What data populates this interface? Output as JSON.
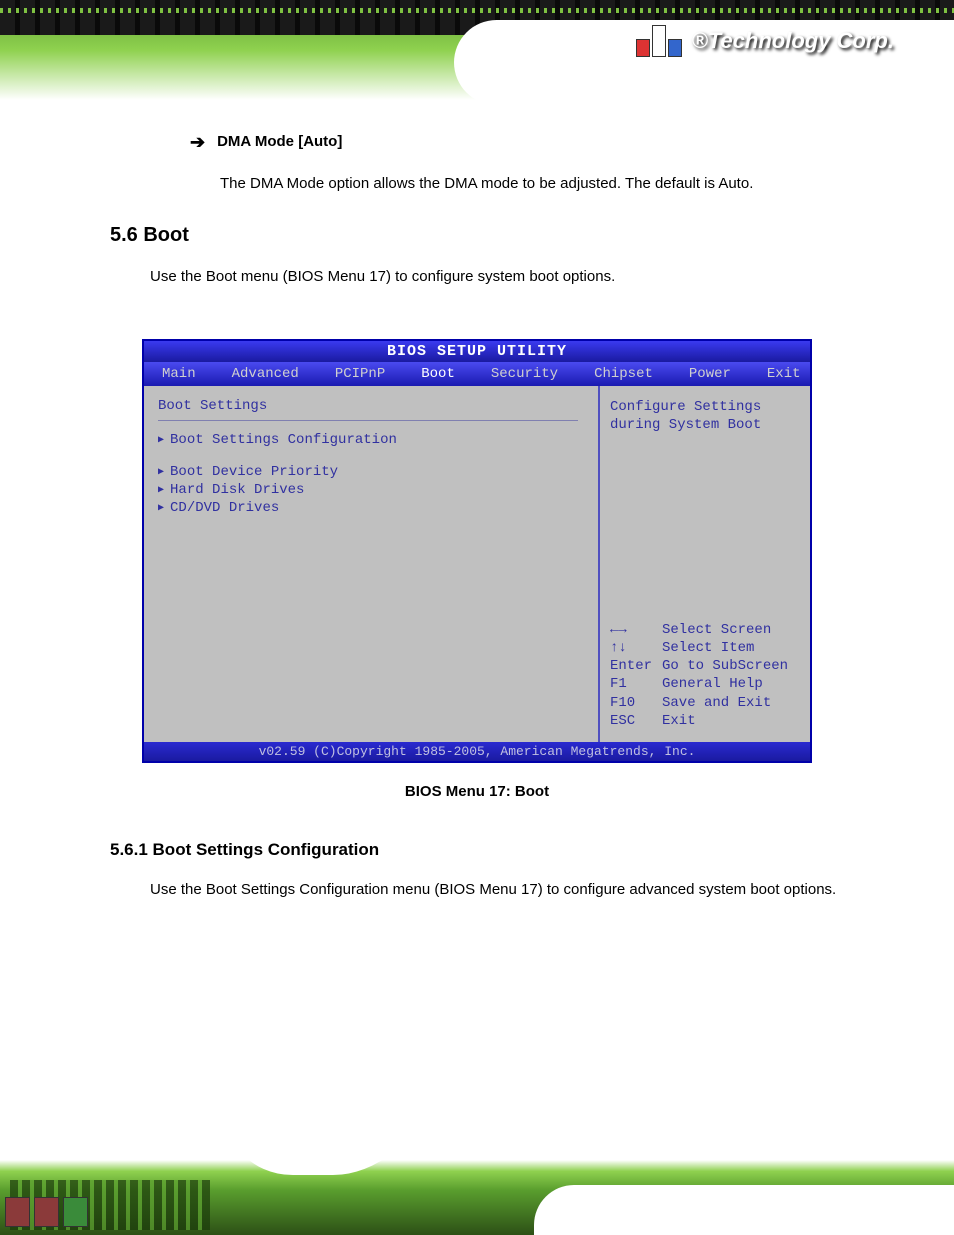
{
  "header": {
    "brand": "®Technology Corp."
  },
  "content": {
    "item1_label": "DMA Mode [Auto]",
    "item1_desc": "The DMA Mode option allows the DMA mode to be adjusted. The default is Auto.",
    "section_heading": "5.6 Boot",
    "section_desc": "Use the Boot menu (BIOS Menu 17) to configure system boot options."
  },
  "bios": {
    "title": "BIOS SETUP UTILITY",
    "tabs": [
      "Main",
      "Advanced",
      "PCIPnP",
      "Boot",
      "Security",
      "Chipset",
      "Power",
      "Exit"
    ],
    "active_tab_index": 3,
    "panel_title": "Boot Settings",
    "menu_items": [
      "Boot Settings Configuration",
      "Boot Device Priority",
      "Hard Disk Drives",
      "CD/DVD Drives"
    ],
    "help_text": "Configure Settings during System Boot",
    "keys": [
      {
        "key": "←→",
        "action": "Select Screen"
      },
      {
        "key": "↑↓",
        "action": "Select Item"
      },
      {
        "key": "Enter",
        "action": "Go to SubScreen"
      },
      {
        "key": "F1",
        "action": "General Help"
      },
      {
        "key": "F10",
        "action": "Save and Exit"
      },
      {
        "key": "ESC",
        "action": "Exit"
      }
    ],
    "footer": "v02.59 (C)Copyright 1985-2005, American Megatrends, Inc."
  },
  "caption": "BIOS Menu 17: Boot",
  "subsection": {
    "heading": "5.6.1 Boot Settings Configuration",
    "desc": "Use the Boot Settings Configuration menu (BIOS Menu 17) to configure advanced system boot options."
  }
}
